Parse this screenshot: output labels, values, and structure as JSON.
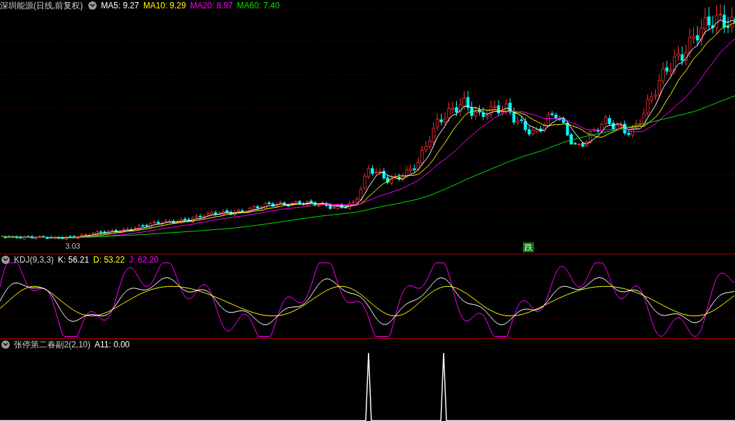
{
  "main_panel": {
    "title": "深圳能源(日线,前复权)",
    "indicators": [
      {
        "label": "MA5: 9.27",
        "color": "#ffffff"
      },
      {
        "label": "MA10: 9.29",
        "color": "#ffff00"
      },
      {
        "label": "MA20: 8.97",
        "color": "#ff00ff"
      },
      {
        "label": "MA60: 7.40",
        "color": "#00e600"
      }
    ],
    "low_label": "3.03",
    "signal_label": "跌"
  },
  "kdj_panel": {
    "title": "KDJ(9,3,3)",
    "indicators": [
      {
        "label": "K: 56.21",
        "color": "#ffffff"
      },
      {
        "label": "D: 53.22",
        "color": "#ffff00"
      },
      {
        "label": "J: 62.20",
        "color": "#ff00ff"
      }
    ]
  },
  "bottom_panel": {
    "title": "张停第二春副2(2,10)",
    "indicators": [
      {
        "label": "A11: 0.00",
        "color": "#ffffff"
      }
    ]
  }
}
